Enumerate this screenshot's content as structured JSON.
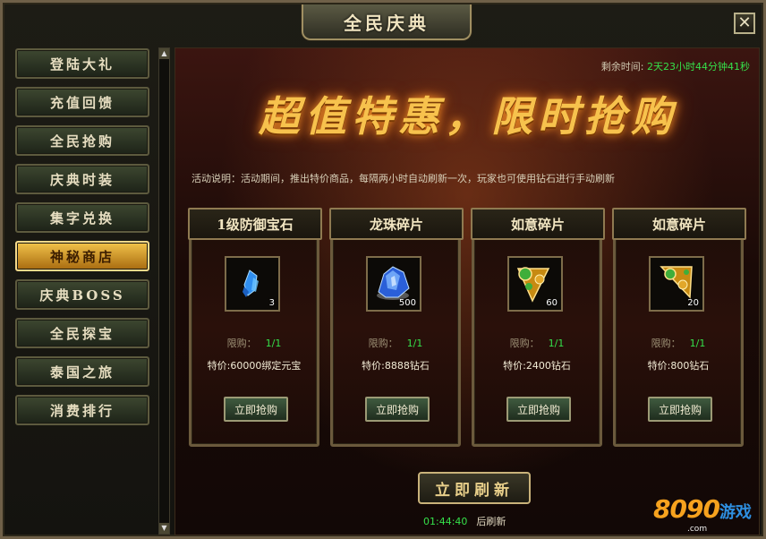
{
  "window": {
    "title": "全民庆典",
    "close_label": "✕"
  },
  "sidebar": {
    "items": [
      {
        "label": "登陆大礼",
        "active": false
      },
      {
        "label": "充值回馈",
        "active": false
      },
      {
        "label": "全民抢购",
        "active": false
      },
      {
        "label": "庆典时装",
        "active": false
      },
      {
        "label": "集字兑换",
        "active": false
      },
      {
        "label": "神秘商店",
        "active": true
      },
      {
        "label": "庆典BOSS",
        "active": false
      },
      {
        "label": "全民探宝",
        "active": false
      },
      {
        "label": "泰国之旅",
        "active": false
      },
      {
        "label": "消费排行",
        "active": false
      }
    ]
  },
  "main": {
    "timer_label": "剩余时间:",
    "timer_value": "2天23小时44分钟41秒",
    "banner": "超值特惠，限时抢购",
    "description": "活动说明：活动期间，推出特价商品，每隔两小时自动刷新一次，玩家也可使用钻石进行手动刷新",
    "cards": [
      {
        "title": "1级防御宝石",
        "qty": "3",
        "limit_label": "限购：",
        "limit_value": "1/1",
        "price": "特价:60000绑定元宝",
        "button": "立即抢购",
        "icon": "blue-crystal-icon"
      },
      {
        "title": "龙珠碎片",
        "qty": "500",
        "limit_label": "限购：",
        "limit_value": "1/1",
        "price": "特价:8888钻石",
        "button": "立即抢购",
        "icon": "dragon-orb-shard-icon"
      },
      {
        "title": "如意碎片",
        "qty": "60",
        "limit_label": "限购：",
        "limit_value": "1/1",
        "price": "特价:2400钻石",
        "button": "立即抢购",
        "icon": "ruyi-shard-icon"
      },
      {
        "title": "如意碎片",
        "qty": "20",
        "limit_label": "限购：",
        "limit_value": "1/1",
        "price": "特价:800钻石",
        "button": "立即抢购",
        "icon": "ruyi-shard-icon"
      }
    ],
    "refresh_button": "立即刷新",
    "countdown_value": "01:44:40",
    "countdown_label": "后刷新"
  },
  "watermark": {
    "number": "8090",
    "text": "游戏",
    "domain": ".com"
  },
  "colors": {
    "accent_gold": "#f7c24d",
    "timer_green": "#35e04a",
    "active_tab": "#f2c34a"
  }
}
